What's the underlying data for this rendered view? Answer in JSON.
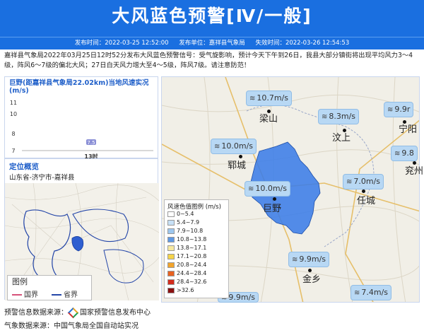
{
  "header": {
    "title": "大风蓝色预警[Ⅳ/一般]",
    "publish_time": "发布时间：2022-03-25 12:52:00",
    "publisher": "发布单位：嘉祥县气象局",
    "expire_time": "失效时间：2022-03-26 12:54:53"
  },
  "description": "嘉祥县气象局2022年03月25日12时52分发布大风蓝色预警信号：受气旋影响，预计今天下午到26日，我县大部分镇街将出现平均风力3～4级，阵风6～7级的偏北大风；27日白天风力增大至4～5级，阵风7级。请注意防范！",
  "station_panel": {
    "title": "巨野(距嘉祥县气象局22.02km)当地风速实况(m/s)"
  },
  "chart_data": {
    "type": "bar",
    "categories": [
      "13时"
    ],
    "values": [
      7.5
    ],
    "data_labels": [
      "7.5"
    ],
    "yticks": [
      "11",
      "10",
      "8",
      "7"
    ],
    "ylim": [
      7,
      11
    ]
  },
  "location_panel": {
    "title": "定位概览",
    "location": "山东省-济宁市-嘉祥县"
  },
  "mini_legend": {
    "title": "图例",
    "items": [
      "国界",
      "省界"
    ]
  },
  "map": {
    "bubbles": [
      {
        "text": "10.7m/s"
      },
      {
        "text": "8.3m/s"
      },
      {
        "text": "9.9r"
      },
      {
        "text": "10.0m/s"
      },
      {
        "text": "9.8"
      },
      {
        "text": "10.0m/s"
      },
      {
        "text": "7.0m/s"
      },
      {
        "text": "9.9m/s"
      },
      {
        "text": "7.4m/s"
      },
      {
        "text": "9.9m/s"
      }
    ],
    "cities": [
      "梁山",
      "汶上",
      "宁阳",
      "郓城",
      "兖州",
      "巨野",
      "任城",
      "金乡"
    ],
    "colors": {
      "accent": "#1a6fe0",
      "warning_area": "#3b7de8"
    }
  },
  "wind_legend": {
    "title": "风速色值图例 (m/s)",
    "items": [
      {
        "label": "0~5.4",
        "color": "#ffffff"
      },
      {
        "label": "5.4~7.9",
        "color": "#c7e0f6"
      },
      {
        "label": "7.9~10.8",
        "color": "#9dc7ef"
      },
      {
        "label": "10.8~13.8",
        "color": "#5e98e3"
      },
      {
        "label": "13.8~17.1",
        "color": "#f7e9a0"
      },
      {
        "label": "17.1~20.8",
        "color": "#f5d44a"
      },
      {
        "label": "20.8~24.4",
        "color": "#f2a42c"
      },
      {
        "label": "24.4~28.4",
        "color": "#e86221"
      },
      {
        "label": "28.4~32.6",
        "color": "#d32c1d"
      },
      {
        "label": ">32.6",
        "color": "#8b1010"
      }
    ]
  },
  "footer": {
    "warning_source_label": "预警信息数据来源：",
    "warning_source": "国家预警信息发布中心",
    "weather_source": "气象数据来源：中国气象局全国自动站实况"
  }
}
